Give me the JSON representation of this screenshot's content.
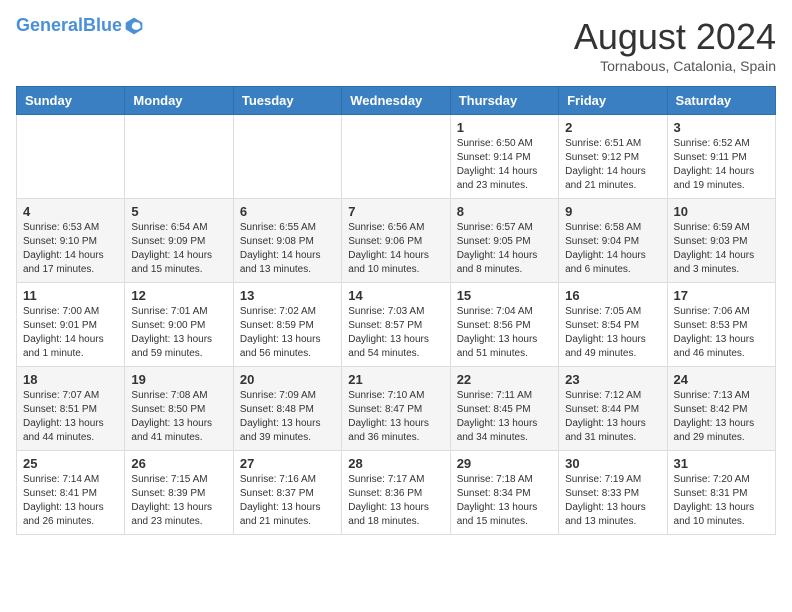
{
  "header": {
    "logo_line1": "General",
    "logo_line2": "Blue",
    "month": "August 2024",
    "location": "Tornabous, Catalonia, Spain"
  },
  "weekdays": [
    "Sunday",
    "Monday",
    "Tuesday",
    "Wednesday",
    "Thursday",
    "Friday",
    "Saturday"
  ],
  "weeks": [
    [
      {
        "day": "",
        "info": ""
      },
      {
        "day": "",
        "info": ""
      },
      {
        "day": "",
        "info": ""
      },
      {
        "day": "",
        "info": ""
      },
      {
        "day": "1",
        "info": "Sunrise: 6:50 AM\nSunset: 9:14 PM\nDaylight: 14 hours\nand 23 minutes."
      },
      {
        "day": "2",
        "info": "Sunrise: 6:51 AM\nSunset: 9:12 PM\nDaylight: 14 hours\nand 21 minutes."
      },
      {
        "day": "3",
        "info": "Sunrise: 6:52 AM\nSunset: 9:11 PM\nDaylight: 14 hours\nand 19 minutes."
      }
    ],
    [
      {
        "day": "4",
        "info": "Sunrise: 6:53 AM\nSunset: 9:10 PM\nDaylight: 14 hours\nand 17 minutes."
      },
      {
        "day": "5",
        "info": "Sunrise: 6:54 AM\nSunset: 9:09 PM\nDaylight: 14 hours\nand 15 minutes."
      },
      {
        "day": "6",
        "info": "Sunrise: 6:55 AM\nSunset: 9:08 PM\nDaylight: 14 hours\nand 13 minutes."
      },
      {
        "day": "7",
        "info": "Sunrise: 6:56 AM\nSunset: 9:06 PM\nDaylight: 14 hours\nand 10 minutes."
      },
      {
        "day": "8",
        "info": "Sunrise: 6:57 AM\nSunset: 9:05 PM\nDaylight: 14 hours\nand 8 minutes."
      },
      {
        "day": "9",
        "info": "Sunrise: 6:58 AM\nSunset: 9:04 PM\nDaylight: 14 hours\nand 6 minutes."
      },
      {
        "day": "10",
        "info": "Sunrise: 6:59 AM\nSunset: 9:03 PM\nDaylight: 14 hours\nand 3 minutes."
      }
    ],
    [
      {
        "day": "11",
        "info": "Sunrise: 7:00 AM\nSunset: 9:01 PM\nDaylight: 14 hours\nand 1 minute."
      },
      {
        "day": "12",
        "info": "Sunrise: 7:01 AM\nSunset: 9:00 PM\nDaylight: 13 hours\nand 59 minutes."
      },
      {
        "day": "13",
        "info": "Sunrise: 7:02 AM\nSunset: 8:59 PM\nDaylight: 13 hours\nand 56 minutes."
      },
      {
        "day": "14",
        "info": "Sunrise: 7:03 AM\nSunset: 8:57 PM\nDaylight: 13 hours\nand 54 minutes."
      },
      {
        "day": "15",
        "info": "Sunrise: 7:04 AM\nSunset: 8:56 PM\nDaylight: 13 hours\nand 51 minutes."
      },
      {
        "day": "16",
        "info": "Sunrise: 7:05 AM\nSunset: 8:54 PM\nDaylight: 13 hours\nand 49 minutes."
      },
      {
        "day": "17",
        "info": "Sunrise: 7:06 AM\nSunset: 8:53 PM\nDaylight: 13 hours\nand 46 minutes."
      }
    ],
    [
      {
        "day": "18",
        "info": "Sunrise: 7:07 AM\nSunset: 8:51 PM\nDaylight: 13 hours\nand 44 minutes."
      },
      {
        "day": "19",
        "info": "Sunrise: 7:08 AM\nSunset: 8:50 PM\nDaylight: 13 hours\nand 41 minutes."
      },
      {
        "day": "20",
        "info": "Sunrise: 7:09 AM\nSunset: 8:48 PM\nDaylight: 13 hours\nand 39 minutes."
      },
      {
        "day": "21",
        "info": "Sunrise: 7:10 AM\nSunset: 8:47 PM\nDaylight: 13 hours\nand 36 minutes."
      },
      {
        "day": "22",
        "info": "Sunrise: 7:11 AM\nSunset: 8:45 PM\nDaylight: 13 hours\nand 34 minutes."
      },
      {
        "day": "23",
        "info": "Sunrise: 7:12 AM\nSunset: 8:44 PM\nDaylight: 13 hours\nand 31 minutes."
      },
      {
        "day": "24",
        "info": "Sunrise: 7:13 AM\nSunset: 8:42 PM\nDaylight: 13 hours\nand 29 minutes."
      }
    ],
    [
      {
        "day": "25",
        "info": "Sunrise: 7:14 AM\nSunset: 8:41 PM\nDaylight: 13 hours\nand 26 minutes."
      },
      {
        "day": "26",
        "info": "Sunrise: 7:15 AM\nSunset: 8:39 PM\nDaylight: 13 hours\nand 23 minutes."
      },
      {
        "day": "27",
        "info": "Sunrise: 7:16 AM\nSunset: 8:37 PM\nDaylight: 13 hours\nand 21 minutes."
      },
      {
        "day": "28",
        "info": "Sunrise: 7:17 AM\nSunset: 8:36 PM\nDaylight: 13 hours\nand 18 minutes."
      },
      {
        "day": "29",
        "info": "Sunrise: 7:18 AM\nSunset: 8:34 PM\nDaylight: 13 hours\nand 15 minutes."
      },
      {
        "day": "30",
        "info": "Sunrise: 7:19 AM\nSunset: 8:33 PM\nDaylight: 13 hours\nand 13 minutes."
      },
      {
        "day": "31",
        "info": "Sunrise: 7:20 AM\nSunset: 8:31 PM\nDaylight: 13 hours\nand 10 minutes."
      }
    ]
  ]
}
